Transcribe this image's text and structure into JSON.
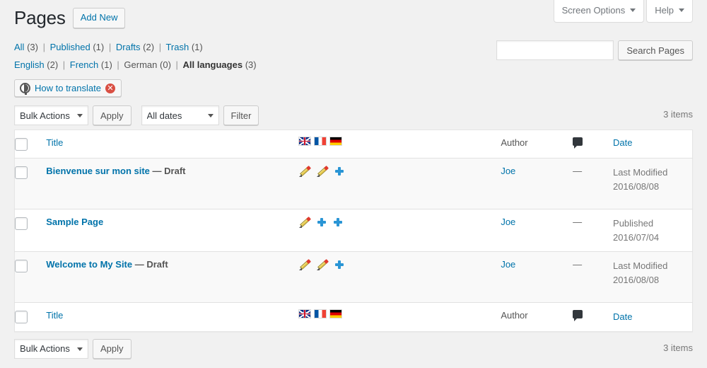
{
  "top_tabs": [
    {
      "label": "Screen Options",
      "name": "screen-options-tab"
    },
    {
      "label": "Help",
      "name": "help-tab"
    }
  ],
  "header": {
    "title": "Pages",
    "add_new_label": "Add New"
  },
  "search": {
    "value": "",
    "placeholder": "",
    "submit_label": "Search Pages"
  },
  "status_filters": [
    {
      "label": "All",
      "count": "(3)",
      "current": false
    },
    {
      "label": "Published",
      "count": "(1)",
      "current": false
    },
    {
      "label": "Drafts",
      "count": "(2)",
      "current": false
    },
    {
      "label": "Trash",
      "count": "(1)",
      "current": false
    }
  ],
  "language_filters": [
    {
      "label": "English",
      "count": "(2)",
      "current": false
    },
    {
      "label": "French",
      "count": "(1)",
      "current": false
    },
    {
      "label": "German",
      "count": "(0)",
      "current": false
    },
    {
      "label": "All languages",
      "count": "(3)",
      "current": true
    }
  ],
  "separator": "|",
  "how_to_translate": {
    "label": "How to translate",
    "close_glyph": "✕"
  },
  "tablenav_top": {
    "bulk_actions_value": "Bulk Actions",
    "apply_label": "Apply",
    "dates_value": "All dates",
    "filter_label": "Filter",
    "displaying_num": "3 items"
  },
  "tablenav_bottom": {
    "bulk_actions_value": "Bulk Actions",
    "apply_label": "Apply",
    "displaying_num": "3 items"
  },
  "table": {
    "columns": {
      "title": "Title",
      "author": "Author",
      "date": "Date"
    },
    "language_flags": [
      {
        "name": "flag-english",
        "code": "uk"
      },
      {
        "name": "flag-french",
        "code": "fr"
      },
      {
        "name": "flag-german",
        "code": "de"
      }
    ],
    "rows": [
      {
        "title": "Bienvenue sur mon site",
        "state": "— Draft",
        "lang_icons": [
          "pencil",
          "pencil",
          "plus"
        ],
        "author": "Joe",
        "comments": "—",
        "date_label": "Last Modified",
        "date_value": "2016/08/08"
      },
      {
        "title": "Sample Page",
        "state": "",
        "lang_icons": [
          "pencil",
          "plus",
          "plus"
        ],
        "author": "Joe",
        "comments": "—",
        "date_label": "Published",
        "date_value": "2016/07/04"
      },
      {
        "title": "Welcome to My Site",
        "state": "— Draft",
        "lang_icons": [
          "pencil",
          "pencil",
          "plus"
        ],
        "author": "Joe",
        "comments": "—",
        "date_label": "Last Modified",
        "date_value": "2016/08/08"
      }
    ]
  },
  "colors": {
    "link": "#0073aa",
    "page_bg": "#f1f1f1",
    "table_bg": "#ffffff",
    "alt_row_bg": "#f9f9f9",
    "plus_icon": "#2a95d5",
    "close_badge": "#d94f43"
  }
}
